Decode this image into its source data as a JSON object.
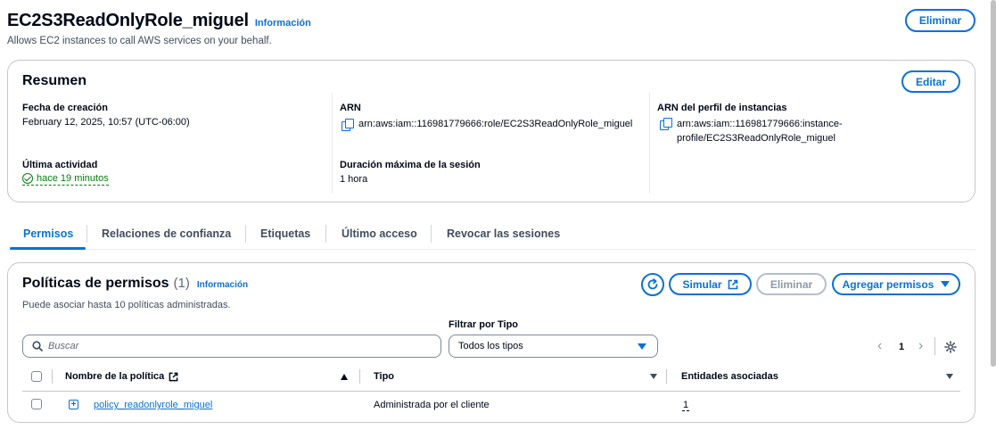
{
  "header": {
    "role_name": "EC2S3ReadOnlyRole_miguel",
    "info_label": "Información",
    "description": "Allows EC2 instances to call AWS services on your behalf.",
    "delete_label": "Eliminar"
  },
  "summary": {
    "title": "Resumen",
    "edit_label": "Editar",
    "created_label": "Fecha de creación",
    "created_value": "February 12, 2025, 10:57 (UTC-06:00)",
    "last_activity_label": "Última actividad",
    "last_activity_value": "hace 19 minutos",
    "arn_label": "ARN",
    "arn_value": "arn:aws:iam::116981779666:role/EC2S3ReadOnlyRole_miguel",
    "max_session_label": "Duración máxima de la sesión",
    "max_session_value": "1 hora",
    "instance_profile_label": "ARN del perfil de instancias",
    "instance_profile_line1": "arn:aws:iam::116981779666:instance-",
    "instance_profile_line2": "profile/EC2S3ReadOnlyRole_miguel"
  },
  "tabs": [
    {
      "label": "Permisos",
      "active": true
    },
    {
      "label": "Relaciones de confianza",
      "active": false
    },
    {
      "label": "Etiquetas",
      "active": false
    },
    {
      "label": "Último acceso",
      "active": false
    },
    {
      "label": "Revocar las sesiones",
      "active": false
    }
  ],
  "permissions": {
    "title": "Políticas de permisos",
    "count": "(1)",
    "info_label": "Información",
    "subtitle": "Puede asociar hasta 10 políticas administradas.",
    "simulate_label": "Simular",
    "remove_label": "Eliminar",
    "add_label": "Agregar permisos",
    "filter_label": "Filtrar por Tipo",
    "search_placeholder": "Buscar",
    "type_select_value": "Todos los tipos",
    "page": "1",
    "columns": [
      "Nombre de la política",
      "Tipo",
      "Entidades asociadas"
    ],
    "rows": [
      {
        "name": "policy_readonlyrole_miguel",
        "type": "Administrada por el cliente",
        "entities": "1"
      }
    ]
  },
  "colors": {
    "accent": "#0972d3",
    "success": "#037f0c",
    "text": "#000716",
    "border": "#c6c6cd"
  },
  "icons": [
    "copy-icon",
    "check-circle-icon",
    "refresh-icon",
    "external-link-icon",
    "caret-down-icon",
    "search-icon",
    "settings-icon",
    "expand-icon"
  ]
}
